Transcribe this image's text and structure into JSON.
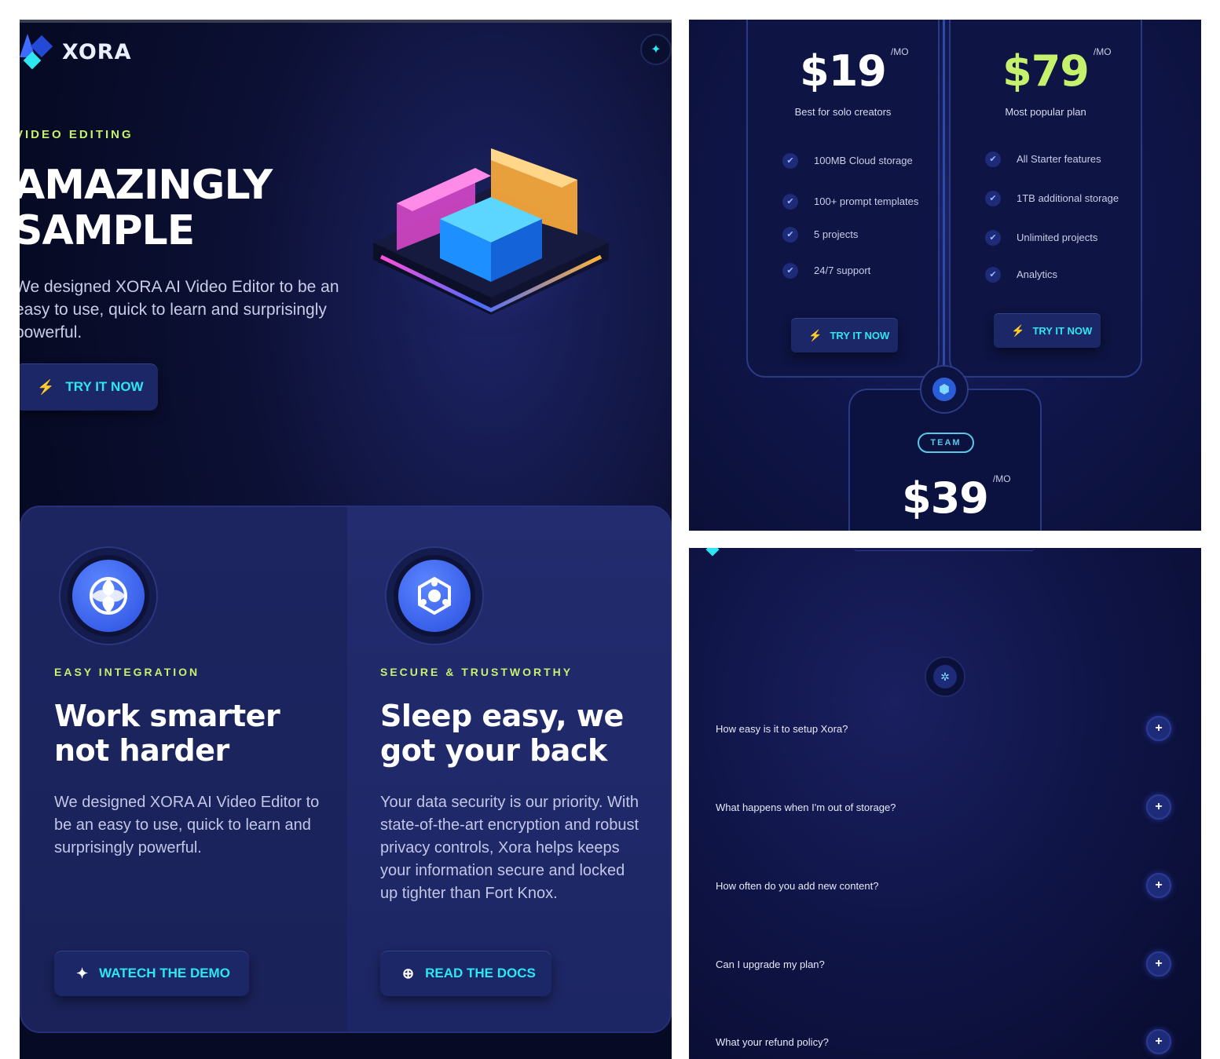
{
  "hero": {
    "logo_text": "XORA",
    "eyebrow": "VIDEO EDITING",
    "title_line1": "AMAZINGLY",
    "title_line2": "SAMPLE",
    "description": "We designed XORA AI Video Editor to be an easy to use, quick to learn and surprisingly powerful.",
    "cta_label": "TRY IT NOW"
  },
  "features": [
    {
      "eyebrow": "EASY INTEGRATION",
      "title": "Work smarter not harder",
      "description": "We designed XORA AI Video Editor to be an easy to use, quick to learn and surprisingly powerful.",
      "button_label": "WATECH THE DEMO"
    },
    {
      "eyebrow": "SECURE & TRUSTWORTHY",
      "title": "Sleep easy, we got your back",
      "description": "Your data security is our priority. With state-of-the-art encryption and robust privacy controls, Xora helps keeps your information secure and locked up tighter than Fort Knox.",
      "button_label": "READ THE DOCS"
    }
  ],
  "pricing": {
    "plans": [
      {
        "price": "$19",
        "period": "/MO",
        "subtitle": "Best for solo creators",
        "features": [
          "100MB Cloud storage",
          "100+ prompt templates",
          "5 projects",
          "24/7 support"
        ],
        "button_label": "TRY IT NOW",
        "price_color": "#ffffff"
      },
      {
        "price": "$79",
        "period": "/MO",
        "subtitle": "Most popular plan",
        "features": [
          "All Starter features",
          "1TB additional storage",
          "Unlimited projects",
          "Analytics"
        ],
        "button_label": "TRY IT NOW",
        "price_color": "#c6f16d"
      }
    ],
    "team": {
      "badge": "TEAM",
      "price": "$39",
      "period": "/MO"
    }
  },
  "faq": {
    "questions": [
      "How easy is it to setup Xora?",
      "What happens when I'm out of storage?",
      "How often do you add new content?",
      "Can I upgrade my plan?",
      "What your refund policy?"
    ],
    "expand_icon": "+"
  },
  "colors": {
    "accent_lime": "#c6f16d",
    "accent_cyan": "#2ee6f2",
    "background_navy": "#0c1034",
    "button_bg": "#1b2766"
  }
}
